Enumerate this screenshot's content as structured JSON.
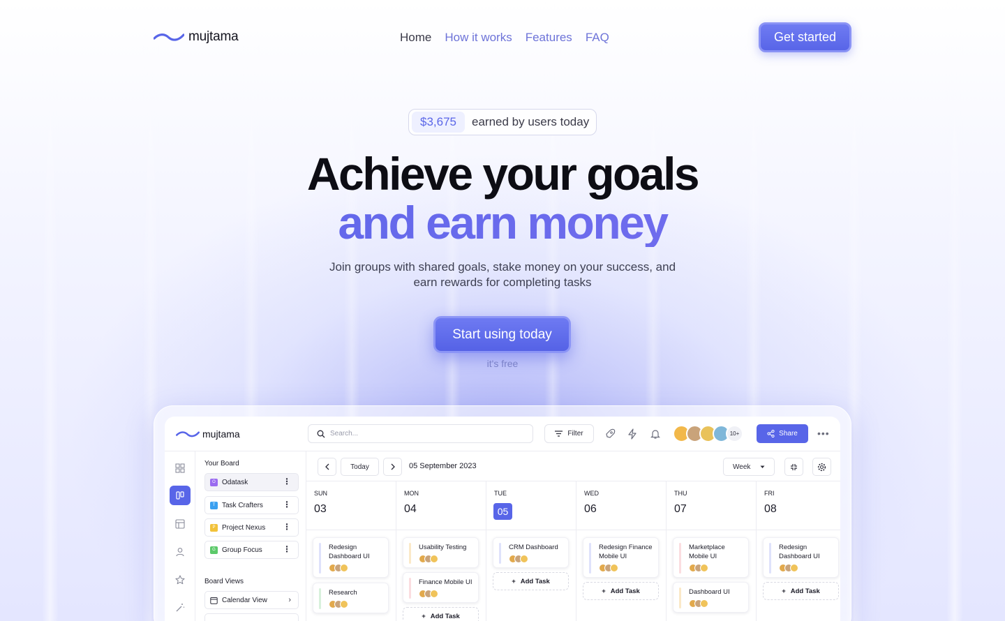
{
  "brand": {
    "name": "mujtama",
    "accent": "#5865e8"
  },
  "nav": {
    "links": [
      {
        "label": "Home",
        "active": true
      },
      {
        "label": "How it works",
        "active": false
      },
      {
        "label": "Features",
        "active": false
      },
      {
        "label": "FAQ",
        "active": false
      }
    ],
    "cta_label": "Get started"
  },
  "hero": {
    "pill_amount": "$3,675",
    "pill_text": "earned by users today",
    "title_line1": "Achieve your goals",
    "title_line2": "and earn money",
    "subtitle": "Join groups with shared goals, stake money on your success, and earn rewards for completing tasks",
    "cta_label": "Start using today",
    "cta_note": "it's free"
  },
  "app": {
    "search_placeholder": "Search...",
    "filter_label": "Filter",
    "avatars_more": "10+",
    "share_label": "Share",
    "sidebar": {
      "your_board_label": "Your Board",
      "boards": [
        {
          "label": "Odatask",
          "letter": "O",
          "color": "#9b6cf0",
          "active": true
        },
        {
          "label": "Task Crafters",
          "letter": "T",
          "color": "#3aa0f0",
          "active": false
        },
        {
          "label": "Project Nexus",
          "letter": "P",
          "color": "#f2c23a",
          "active": false
        },
        {
          "label": "Group Focus",
          "letter": "G",
          "color": "#5cc96a",
          "active": false
        }
      ],
      "board_views_label": "Board Views",
      "views": [
        {
          "label": "Calendar View"
        }
      ]
    },
    "calendar": {
      "today_label": "Today",
      "date_label": "05 September 2023",
      "view_label": "Week",
      "days": [
        {
          "name": "SUN",
          "num": "03",
          "today": false
        },
        {
          "name": "MON",
          "num": "04",
          "today": false
        },
        {
          "name": "TUE",
          "num": "05",
          "today": true
        },
        {
          "name": "WED",
          "num": "06",
          "today": false
        },
        {
          "name": "THU",
          "num": "07",
          "today": false
        },
        {
          "name": "FRI",
          "num": "08",
          "today": false
        }
      ],
      "add_task_label": "Add Task",
      "tasks": {
        "sun_1": "Redesign Dashboard UI",
        "sun_2": "Research",
        "mon_1": "Usability Testing",
        "mon_2": "Finance Mobile UI",
        "tue_1": "CRM Dashboard",
        "wed_1": "Redesign Finance Mobile UI",
        "thu_1": "Marketplace Mobile UI",
        "thu_2": "Dashboard UI",
        "fri_1": "Redesign Dashboard UI"
      },
      "task_colors": {
        "blue": "#dfe2fb",
        "yellow": "#fbe9c8",
        "pink": "#fbdde0",
        "green": "#d8f1dc"
      }
    }
  }
}
